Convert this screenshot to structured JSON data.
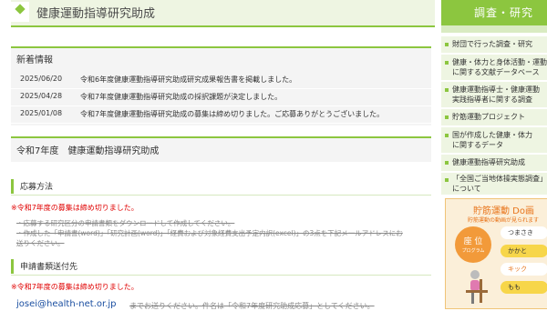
{
  "header": {
    "title": "健康運動指導研究助成"
  },
  "news": {
    "heading": "新着情報",
    "items": [
      {
        "date": "2025/06/20",
        "text": "令和6年度健康運動指導研究助成研究成果報告書を掲載しました。"
      },
      {
        "date": "2025/04/28",
        "text": "令和7年度健康運動指導研究助成の採択課題が決定しました。"
      },
      {
        "date": "2025/01/08",
        "text": "令和7年度健康運動指導研究助成の募集は締め切りました。ご応募ありがとうございました。"
      }
    ]
  },
  "section": {
    "title": "令和7年度　健康運動指導研究助成",
    "apply_heading": "応募方法",
    "closed_note": "※令和7年度の募集は締め切りました。",
    "struck_1": "・応募する研究区分の申請書類をダウンロードして作成してください。",
    "struck_2": "・作成した「申請書(word)」「研究計画(word)」「経費および対象経費支出予定内訳(excel)」の3点を下記メールアドレスにお",
    "struck_3": "送りください。",
    "send_heading": "申請書類送付先",
    "closed_note_2": "※令和7年度の募集は締め切りました。",
    "email": "josei@health-net.or.jp",
    "email_after": "までお送りください。件名は「令和7年度研究助成応募」としてください。"
  },
  "sidebar": {
    "heading": "調査・研究",
    "items": [
      {
        "label": "財団で行った調査・研究"
      },
      {
        "label": "健康・体力と身体活動・運動\nに関する文献データベース"
      },
      {
        "label": "健康運動指導士・健康運動\n実践指導者に関する調査"
      },
      {
        "label": "貯筋運動プロジェクト"
      },
      {
        "label": "国が作成した健康・体力\nに関するデータ"
      },
      {
        "label": "健康運動指導研究助成"
      },
      {
        "label": "「全国ご当地体操実態調査」\nについて"
      }
    ]
  },
  "promo": {
    "title": "貯筋運動 Do画",
    "subtitle": "貯筋運動の動画が見られます",
    "circle_title": "座 位",
    "circle_sub": "プログラム",
    "pills": [
      "つまさき",
      "かかと",
      "キック",
      "もも"
    ]
  },
  "colors": {
    "accent": "#8cc63f",
    "alert": "#e00000",
    "link": "#1a4ea0",
    "promo": "#f29a3a"
  }
}
